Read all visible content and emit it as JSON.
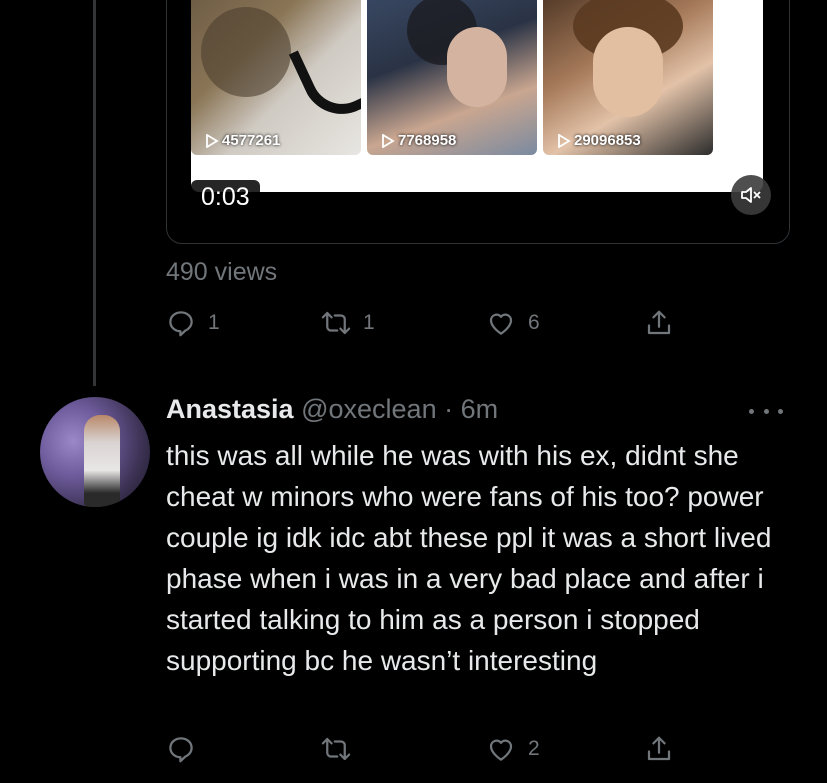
{
  "media": {
    "thumbnails": [
      {
        "views": "4577261"
      },
      {
        "views": "7768958"
      },
      {
        "views": "29096853"
      }
    ],
    "timestamp": "0:03"
  },
  "original_tweet": {
    "views": "490 views",
    "actions": {
      "reply": "1",
      "retweet": "1",
      "like": "6"
    }
  },
  "reply": {
    "name": "Anastasia",
    "handle_time": "@oxeclean · 6m",
    "text": "this was all while he was with his ex, didnt she cheat w minors who were fans of his too? power couple ig idk idc abt these ppl it was a short lived phase when i was in a very bad place and after i started talking to him as a person i stopped supporting bc he wasn’t interesting",
    "actions": {
      "reply": "",
      "retweet": "",
      "like": "2"
    }
  },
  "icons": [
    "play-icon",
    "mute-icon",
    "reply-icon",
    "retweet-icon",
    "like-icon",
    "share-icon",
    "more-icon"
  ]
}
